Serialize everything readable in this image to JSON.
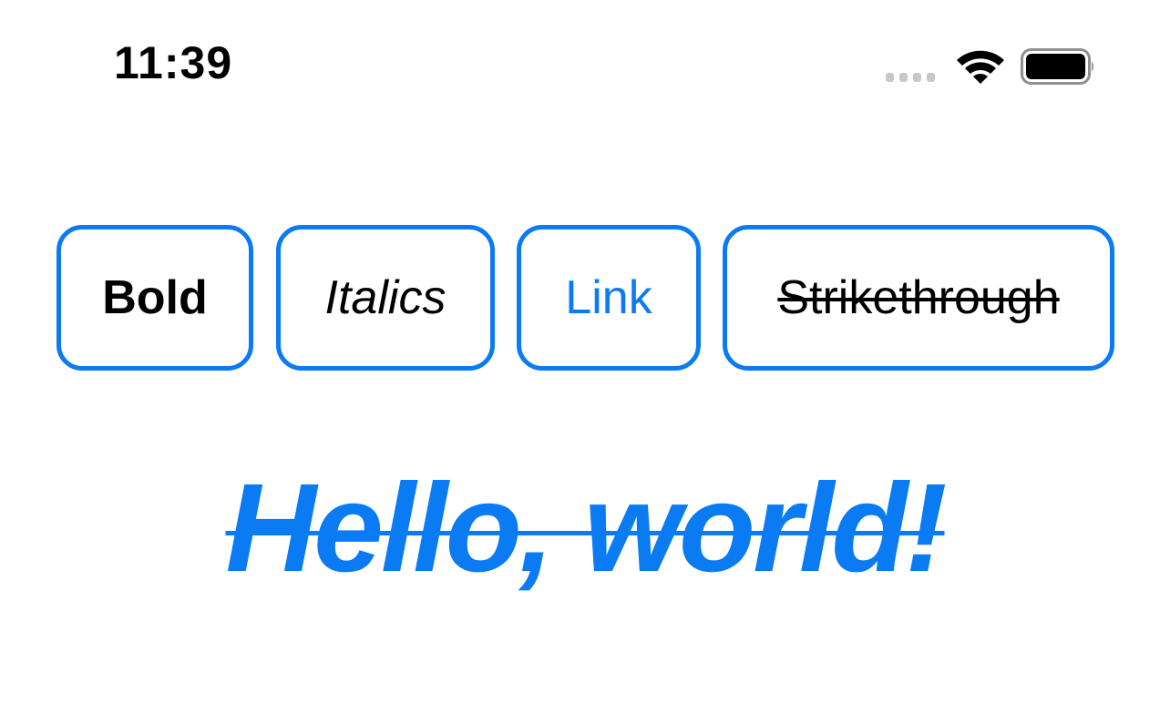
{
  "status_bar": {
    "time": "11:39",
    "icons": [
      "cellular-signal-icon",
      "wifi-icon",
      "battery-icon"
    ]
  },
  "toolbar": {
    "bold_label": "Bold",
    "italics_label": "Italics",
    "link_label": "Link",
    "strikethrough_label": "Strikethrough"
  },
  "content": {
    "text": "Hello, world!"
  },
  "colors": {
    "accent": "#0a7bf2",
    "text": "#000000",
    "background": "#ffffff",
    "inactive_signal": "#c8c8cc"
  }
}
